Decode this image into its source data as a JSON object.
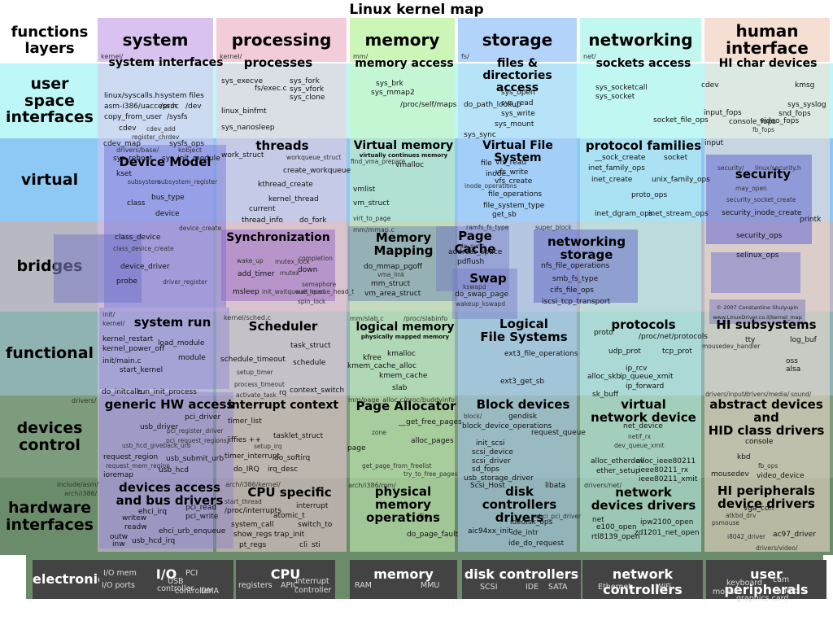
{
  "title": "Linux kernel map",
  "corner_label": "functions\nlayers",
  "columns": [
    {
      "name": "system",
      "dir": "kernel/"
    },
    {
      "name": "processing",
      "dir": "kernel/"
    },
    {
      "name": "memory",
      "dir": "mm/"
    },
    {
      "name": "storage",
      "dir": "fs/"
    },
    {
      "name": "networking",
      "dir": "net/"
    },
    {
      "name": "human\ninterface",
      "dir": ""
    }
  ],
  "rows": [
    {
      "name": "user space\ninterfaces"
    },
    {
      "name": "virtual"
    },
    {
      "name": "bridges"
    },
    {
      "name": "functional"
    },
    {
      "name": "devices\ncontrol"
    },
    {
      "name": "hardware\ninterfaces"
    },
    {
      "name": "electronics"
    }
  ],
  "blocks": {
    "system_interfaces": {
      "title": "system interfaces",
      "labels": [
        "linux/syscalls.h",
        "asm-i386/uaccess.h",
        "copy_from_user",
        "system files",
        "/proc",
        "/dev",
        "/sysfs",
        "cdev",
        "cdev_add",
        "register_chrdev",
        "cdev_map",
        "sysfs_ops",
        "sys_reboot",
        "sys_init_module"
      ]
    },
    "device_model": {
      "title": "Device Model",
      "labels": [
        "drivers/base/",
        "kobject",
        "kset",
        "subsystem",
        "subsystem_register",
        "class",
        "bus_type",
        "device",
        "device_create",
        "class_device",
        "class_device_create",
        "device_driver",
        "probe",
        "driver_register"
      ]
    },
    "system_run": {
      "title": "system run",
      "labels": [
        "init/",
        "kernel/",
        "kernel_restart",
        "kernel_power_off",
        "load_module",
        "module",
        "init/main.c",
        "start_kernel",
        "do_initcalls",
        "run_init_process"
      ]
    },
    "generic_hw_access": {
      "title": "generic HW access",
      "labels": [
        "drivers/",
        "pci_driver",
        "usb_driver",
        "pci_register_driver",
        "pci_request_regions",
        "usb_hcd_giveback_urb",
        "request_region",
        "usb_submit_urb",
        "request_mem_region",
        "usb_hcd",
        "ioremap"
      ]
    },
    "devices_access": {
      "title": "devices access\nand bus drivers",
      "labels": [
        "include/asm/",
        "arch/i386/",
        "ehci_irq",
        "pci_read",
        "writew",
        "pci_write",
        "readw",
        "ehci_urb_enqueue",
        "outw",
        "inw",
        "usb_hcd_irq"
      ]
    },
    "processes": {
      "title": "processes",
      "labels": [
        "sys_execve",
        "fs/exec.c",
        "sys_fork",
        "sys_vfork",
        "sys_clone",
        "linux_binfmt",
        "sys_nanosleep"
      ]
    },
    "threads": {
      "title": "threads",
      "labels": [
        "work_struct",
        "workqueue_struct",
        "create_workqueue",
        "kthread_create",
        "kernel_thread",
        "current",
        "thread_info",
        "do_fork"
      ]
    },
    "synchronization": {
      "title": "Synchronization",
      "labels": [
        "wake_up",
        "mutex_lock",
        "completion",
        "add_timer",
        "mutex",
        "down",
        "semaphore",
        "msleep",
        "init_waitqueue_head",
        "wait_queue_head_t",
        "spin_lock"
      ]
    },
    "scheduler": {
      "title": "Scheduler",
      "labels": [
        "kernel/sched.c",
        "task_struct",
        "schedule_timeout",
        "schedule",
        "setup_timer",
        "process_timeout",
        "activate_task",
        "rq",
        "context_switch"
      ]
    },
    "interrupt_context": {
      "title": "interrupt context",
      "labels": [
        "timer_list",
        "jiffies ++",
        "tasklet_struct",
        "setup_irq",
        "timer_interrupt",
        "do_softirq",
        "do_IRQ",
        "irq_desc"
      ]
    },
    "cpu_specific": {
      "title": "CPU specific",
      "labels": [
        "arch/i386/kernel/",
        "start_thread",
        "interrupt",
        "/proc/interrupts",
        "atomic_t",
        "system_call",
        "switch_to",
        "show_regs",
        "trap_init",
        "pt_regs",
        "cli",
        "sti"
      ]
    },
    "memory_access": {
      "title": "memory access",
      "labels": [
        "sys_brk",
        "sys_mmap2",
        "/proc/self/maps"
      ]
    },
    "virtual_memory": {
      "title": "Virtual memory",
      "sub": "virtually continues memory",
      "labels": [
        "find_vma_prepare",
        "vmalloc",
        "vmlist",
        "vm_struct",
        "virt_to_page"
      ]
    },
    "memory_mapping": {
      "title": "Memory\nMapping",
      "labels": [
        "mm/mmap.c",
        "do_mmap_pgoff",
        "vma_link",
        "mm_struct",
        "vm_area_struct"
      ]
    },
    "logical_memory": {
      "title": "logical memory",
      "sub": "physically mapped memory",
      "labels": [
        "mm/slab.c",
        "/proc/slabinfo",
        "kfree",
        "kmalloc",
        "kmem_cache_alloc",
        "kmem_cache",
        "slab"
      ]
    },
    "page_allocator": {
      "title": "Page Allocator",
      "labels": [
        "mm/page_alloc.c",
        "/proc/buddyinfo",
        "__get_free_pages",
        "zone",
        "alloc_pages",
        "page",
        "get_page_from_freelist",
        "try_to_free_pages"
      ]
    },
    "physical_memory_ops": {
      "title": "physical memory\noperations",
      "labels": [
        "arch/i386/mm/",
        "die",
        "do_page_fault"
      ]
    },
    "files_dirs": {
      "title": "files & directories\naccess",
      "labels": [
        "sys_open",
        "sys_read",
        "do_path_lookup",
        "sys_write",
        "sys_mount",
        "sys_sync"
      ]
    },
    "vfs": {
      "title": "Virtual File System",
      "labels": [
        "file",
        "vfs_read",
        "vfs_write",
        "inode",
        "vfs_create",
        "inode_operations",
        "file_operations",
        "file_system_type",
        "get_sb",
        "ramfs_fs_type",
        "super_block"
      ]
    },
    "page_cache": {
      "title": "Page Cache",
      "labels": [
        "do_sync",
        "address_space",
        "pdflush"
      ]
    },
    "swap": {
      "title": "Swap",
      "labels": [
        "kswapd",
        "do_swap_page",
        "wakeup_kswapd"
      ]
    },
    "networking_storage": {
      "title": "networking\nstorage",
      "labels": [
        "nfs_file_operations",
        "smb_fs_type",
        "cifs_file_ops",
        "iscsi_tcp_transport"
      ]
    },
    "logical_fs": {
      "title": "Logical\nFile Systems",
      "labels": [
        "ext3_file_operations",
        "ext3_get_sb"
      ]
    },
    "block_devices": {
      "title": "Block devices",
      "labels": [
        "block/",
        "gendisk",
        "block_device_operations",
        "request_queue",
        "init_scsi",
        "scsi_device",
        "scsi_driver",
        "sd_fops",
        "usb_storage_driver"
      ]
    },
    "disk_controllers_drivers": {
      "title": "disk\ncontrollers drivers",
      "labels": [
        "Scsi_Host",
        "libata",
        "ahci_pci_driver",
        "idedisk_ops",
        "aic94xx_init",
        "ide_intr",
        "ide_do_request"
      ]
    },
    "sockets_access": {
      "title": "sockets access",
      "labels": [
        "sys_socketcall",
        "sys_socket",
        "socket_file_ops"
      ]
    },
    "protocol_families": {
      "title": "protocol families",
      "labels": [
        "__sock_create",
        "socket",
        "inet_family_ops",
        "inet_create",
        "unix_family_ops",
        "proto_ops",
        "inet_dgram_ops",
        "inet_stream_ops"
      ]
    },
    "protocols": {
      "title": "protocols",
      "labels": [
        "proto",
        "/proc/net/protocols",
        "udp_prot",
        "tcp_prot",
        "ip_rcv",
        "alloc_skb",
        "ip_queue_xmit",
        "ip_forward",
        "sk_buff"
      ]
    },
    "virtual_network_device": {
      "title": "virtual\nnetwork device",
      "labels": [
        "net_device",
        "netif_rx",
        "dev_queue_xmit",
        "alloc_etherdev",
        "alloc_ieee80211",
        "ether_setup",
        "ieee80211_rx",
        "ieee80211_xmit"
      ]
    },
    "network_devices_drivers": {
      "title": "network\ndevices drivers",
      "labels": [
        "drivers/net/",
        "net",
        "e100_open",
        "ipw2100_open",
        "rtl8139_open",
        "zd1201_net_open"
      ]
    },
    "hi_char_devices": {
      "title": "HI char devices",
      "labels": [
        "cdev",
        "kmsg",
        "sys_syslog",
        "input_fops",
        "snd_fops",
        "console_fops",
        "video_fops",
        "fb_fops",
        "input"
      ]
    },
    "security": {
      "title": "security",
      "labels": [
        "security/",
        "linux/security.h",
        "may_open",
        "security_socket_create",
        "security_inode_create",
        "security_ops",
        "selinux_ops",
        "printk"
      ]
    },
    "hi_subsystems": {
      "title": "HI subsystems",
      "labels": [
        "tty",
        "log_buf",
        "mousedev_handler",
        "oss",
        "alsa",
        "drivers/input/",
        "drivers/media/",
        "sound/"
      ]
    },
    "abstract_devices": {
      "title": "abstract devices\nand\nHID class drivers",
      "labels": [
        "console",
        "kbd",
        "fb_ops",
        "mousedev",
        "video_device"
      ]
    },
    "hi_peripherals": {
      "title": "HI peripherals\ndevice drivers",
      "labels": [
        "vga_con",
        "atkbd_drv",
        "psmouse",
        "i8042_driver",
        "ac97_driver",
        "drivers/video/"
      ]
    }
  },
  "hardware": [
    {
      "name": "electronics",
      "labels": []
    },
    {
      "name": "I/O",
      "labels": [
        "I/O mem",
        "PCI",
        "I/O ports",
        "USB",
        "controller",
        "controller",
        "DMA"
      ]
    },
    {
      "name": "CPU",
      "labels": [
        "registers",
        "APIC",
        "interrupt",
        "controller"
      ]
    },
    {
      "name": "memory",
      "labels": [
        "RAM",
        "MMU"
      ]
    },
    {
      "name": "disk controllers",
      "labels": [
        "SCSI",
        "IDE",
        "SATA"
      ]
    },
    {
      "name": "network controllers",
      "labels": [
        "Ethernet",
        "WiFi"
      ]
    },
    {
      "name": "user peripherals",
      "labels": [
        "keyboard",
        "cam",
        "mouse",
        "audio",
        "graphics card"
      ]
    }
  ],
  "copyright": {
    "line1": "© 2007 Constantine Shulyupin",
    "line2": "www.LinuxDriver.co.il/kernel_map"
  },
  "colors": {
    "system": "#d9c2ef",
    "processing": "#f2ccd8",
    "memory": "#ccf5b8",
    "storage": "#b3d4fa",
    "networking": "#c2f7f0",
    "human_interface": "#f5ded2",
    "row_user": "#bdf7f7",
    "row_virtual": "#8ec8f5",
    "row_bridges": "#b8b8c2",
    "row_functional": "#8fb3b3",
    "row_devices": "#7d9c7d",
    "row_hardware": "#6b8c6b",
    "electronics": "#434343"
  }
}
